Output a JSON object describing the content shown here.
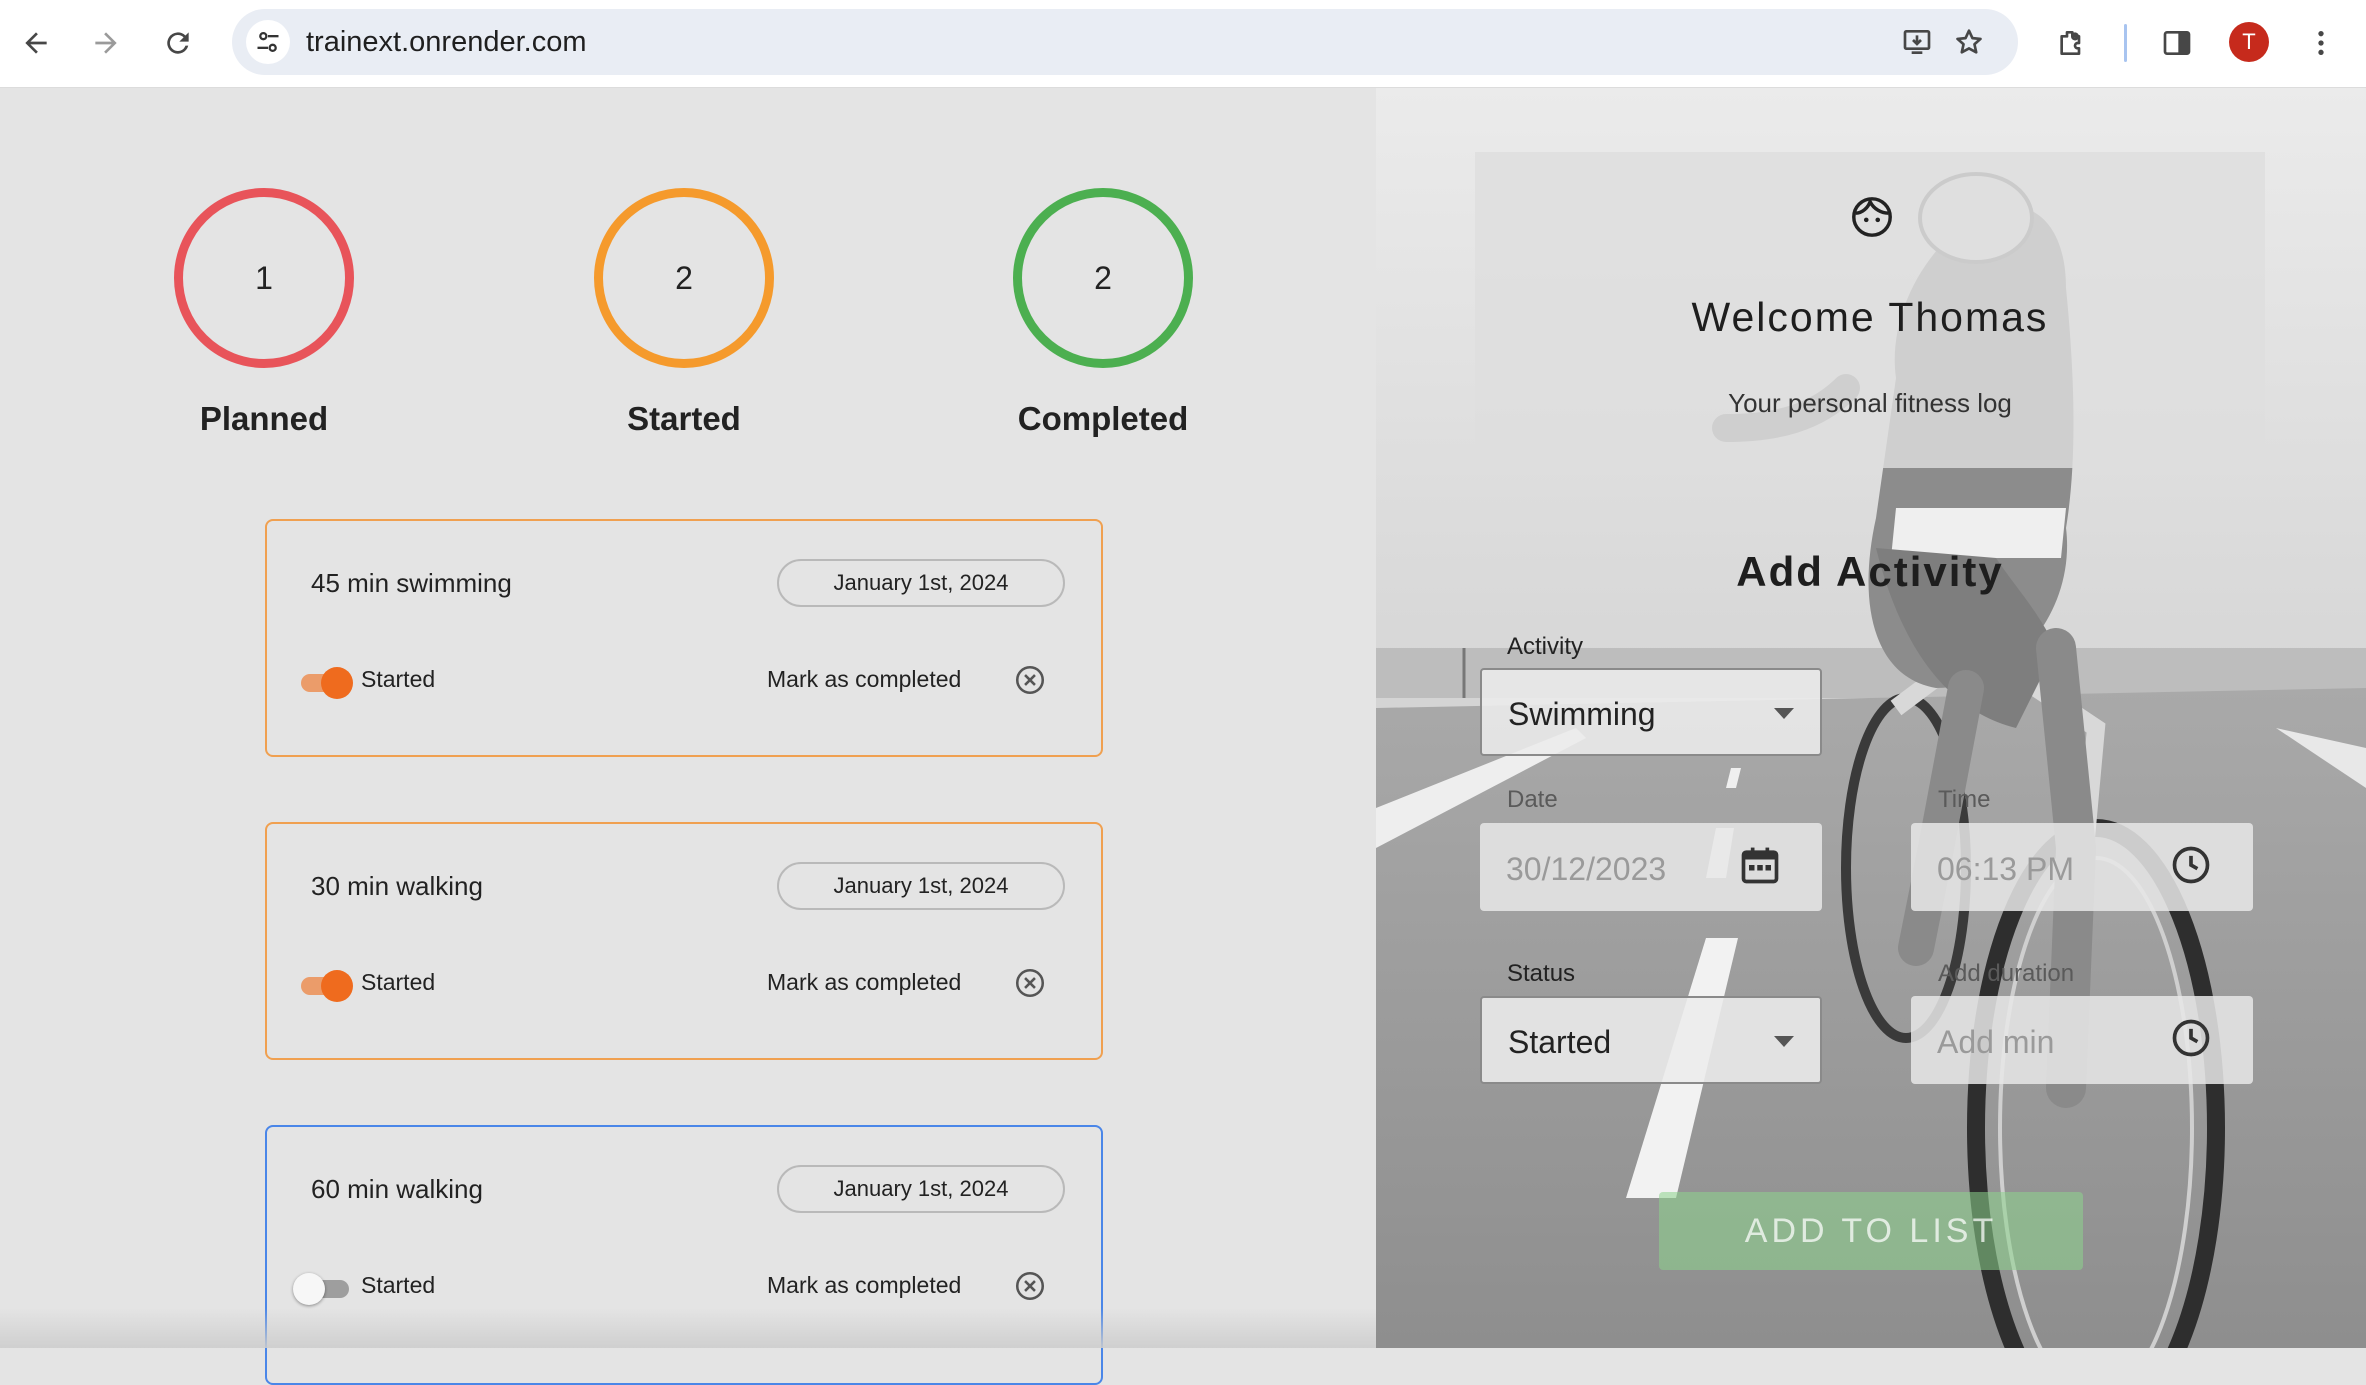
{
  "browser": {
    "url": "trainext.onrender.com",
    "profile_initial": "T",
    "icons": {
      "back": "back-arrow-icon",
      "forward": "forward-arrow-icon",
      "reload": "reload-icon",
      "site_info": "tune-icon",
      "install": "install-app-icon",
      "bookmark": "star-icon",
      "extensions": "puzzle-icon",
      "side_panel": "side-panel-icon",
      "menu": "kebab-menu-icon"
    }
  },
  "stats": [
    {
      "count": "1",
      "label": "Planned",
      "color": "#e8545a"
    },
    {
      "count": "2",
      "label": "Started",
      "color": "#f59a2c"
    },
    {
      "count": "2",
      "label": "Completed",
      "color": "#4caf50"
    }
  ],
  "activities": [
    {
      "title": "45 min swimming",
      "date": "January 1st, 2024",
      "status_label": "Started",
      "toggle_on": true,
      "mark_label": "Mark as completed",
      "border_color": "#f0a050"
    },
    {
      "title": "30 min walking",
      "date": "January 1st, 2024",
      "status_label": "Started",
      "toggle_on": true,
      "mark_label": "Mark as completed",
      "border_color": "#f0a050"
    },
    {
      "title": "60 min walking",
      "date": "January 1st, 2024",
      "status_label": "Started",
      "toggle_on": false,
      "mark_label": "Mark as completed",
      "border_color": "#4a86e8"
    }
  ],
  "welcome": {
    "title": "Welcome Thomas",
    "subtitle": "Your personal fitness log",
    "icon": "face-icon"
  },
  "form": {
    "heading": "Add Activity",
    "activity_label": "Activity",
    "activity_value": "Swimming",
    "date_label": "Date",
    "date_value": "30/12/2023",
    "time_label": "Time",
    "time_value": "06:13 PM",
    "status_label": "Status",
    "status_value": "Started",
    "duration_label": "Add duration",
    "duration_placeholder": "Add min",
    "submit_label": "ADD TO LIST"
  }
}
